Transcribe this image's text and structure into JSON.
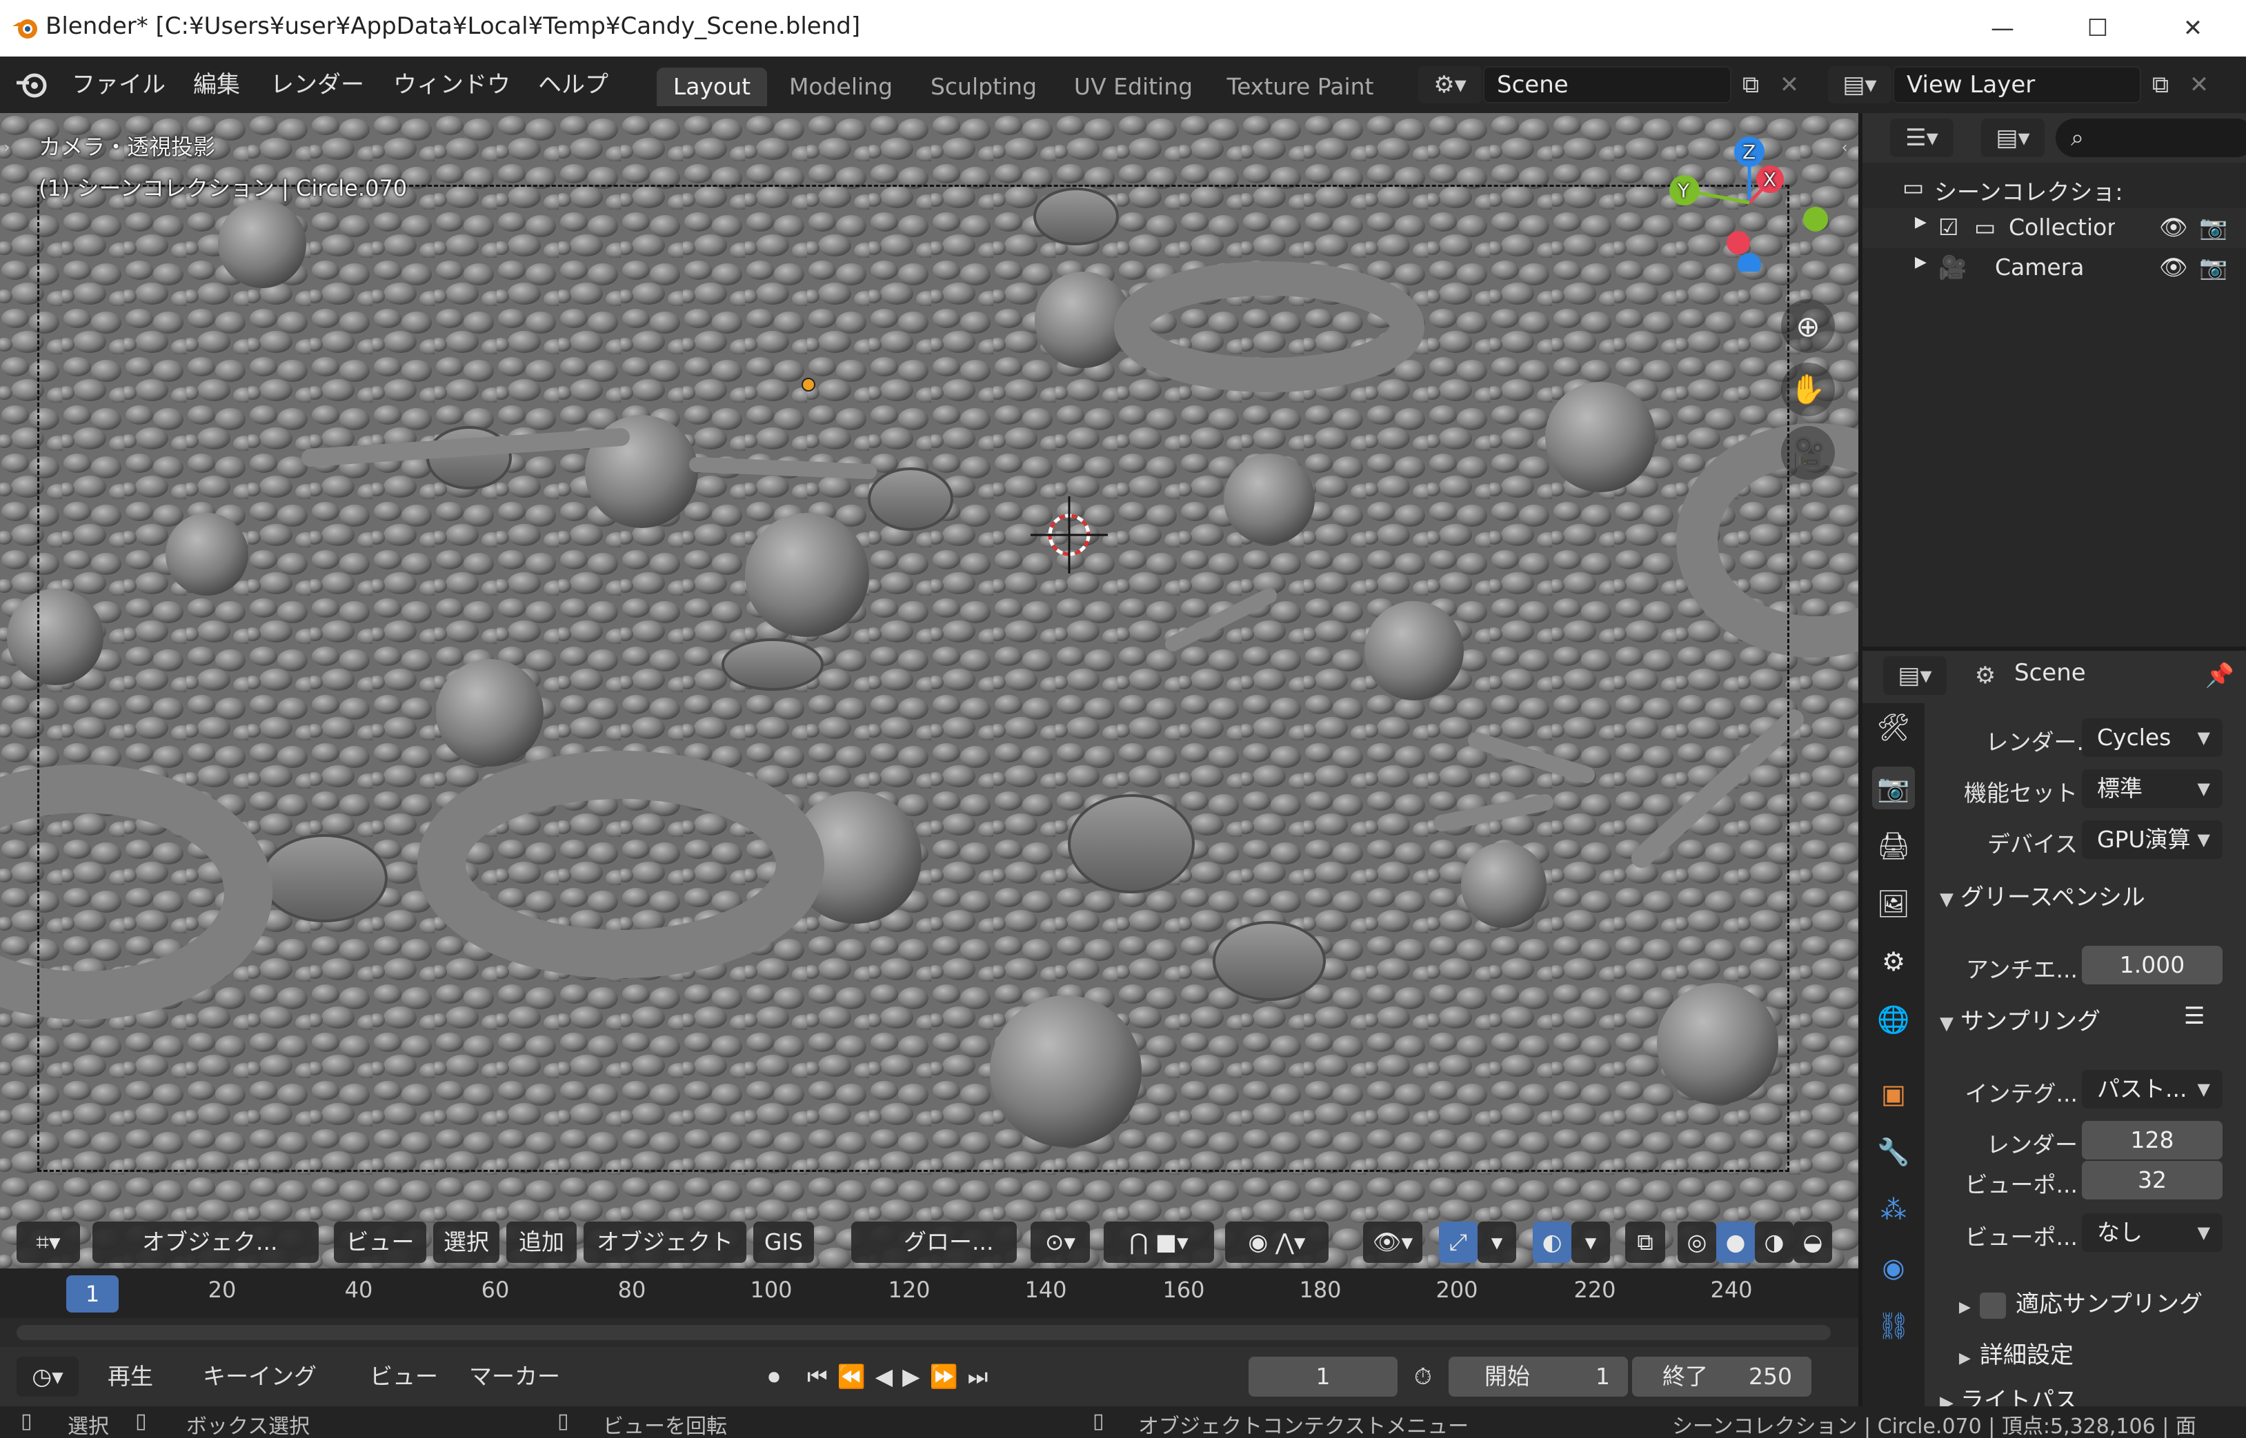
{
  "window": {
    "title": "Blender* [C:¥Users¥user¥AppData¥Local¥Temp¥Candy_Scene.blend]",
    "minimize": "—",
    "maximize": "☐",
    "close": "✕"
  },
  "menu": [
    "ファイル",
    "編集",
    "レンダー",
    "ウィンドウ",
    "ヘルプ"
  ],
  "workspaces": [
    "Layout",
    "Modeling",
    "Sculpting",
    "UV Editing",
    "Texture Paint"
  ],
  "scene_field": "Scene",
  "view_layer_field": "View Layer",
  "viewport": {
    "view_name": "カメラ・透視投影",
    "object_info": "(1) シーンコレクション | Circle.070",
    "gizmo": {
      "z": "Z",
      "y": "Y",
      "x": "X"
    },
    "header": {
      "mode": "オブジェク...",
      "menus": [
        "ビュー",
        "選択",
        "追加",
        "オブジェクト",
        "GIS"
      ],
      "orientation": "グロー..."
    }
  },
  "timeline": {
    "current_frame_badge": "1",
    "ticks": [
      "20",
      "40",
      "60",
      "80",
      "100",
      "120",
      "140",
      "160",
      "180",
      "200",
      "220",
      "240"
    ],
    "menus": [
      "再生",
      "キーイング",
      "ビュー",
      "マーカー"
    ],
    "current_frame": "1",
    "start_label": "開始",
    "start_value": "1",
    "end_label": "終了",
    "end_value": "250"
  },
  "statusbar": {
    "select": "選択",
    "box_select": "ボックス選択",
    "rotate_view": "ビューを回転",
    "context_menu": "オブジェクトコンテクストメニュー",
    "stats": "シーンコレクション | Circle.070 | 頂点:5,328,106 | 面"
  },
  "outliner": {
    "rows": [
      {
        "label": "シーンコレクショ:"
      },
      {
        "label": "Collectior"
      },
      {
        "label": "Camera"
      }
    ]
  },
  "properties": {
    "context": "Scene",
    "render_engine_label": "レンダー...",
    "render_engine": "Cycles",
    "feature_set_label": "機能セット",
    "feature_set": "標準",
    "device_label": "デバイス",
    "device": "GPU演算",
    "grease_pencil_panel": "グリースペンシル",
    "antialias_label": "アンチエ...",
    "antialias_value": "1.000",
    "sampling_panel": "サンプリング",
    "integrator_label": "インテグ...",
    "integrator": "パスト...",
    "render_samples_label": "レンダー",
    "render_samples": "128",
    "viewport_samples_label": "ビューポ...",
    "viewport_samples": "32",
    "viewport_denoise_label": "ビューポ...",
    "viewport_denoise": "なし",
    "adaptive_sampling": "適応サンプリング",
    "advanced": "詳細設定",
    "light_paths": "ライトパス"
  },
  "colors": {
    "accent_blue": "#4772b3",
    "axis_x": "#e94156",
    "axis_y": "#7dbd2a",
    "axis_z": "#2b86e8",
    "viewport_bg": "#6f6f6f"
  }
}
